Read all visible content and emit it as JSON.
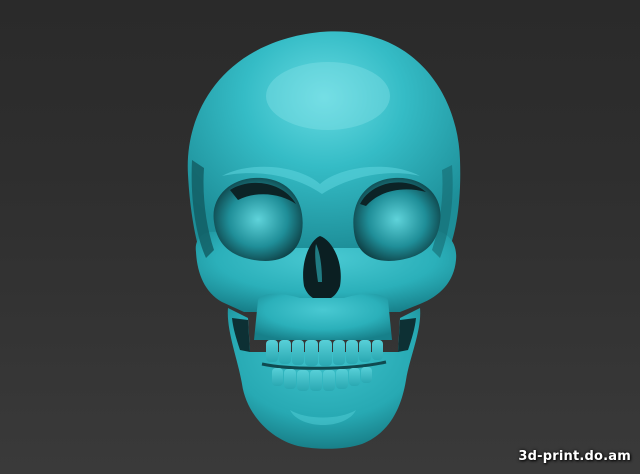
{
  "scene": {
    "subject": "skull-model",
    "background_color": "#2e2e2e",
    "model_color": "#2fb3bd"
  },
  "watermark": {
    "text": "3d-print.do.am"
  }
}
